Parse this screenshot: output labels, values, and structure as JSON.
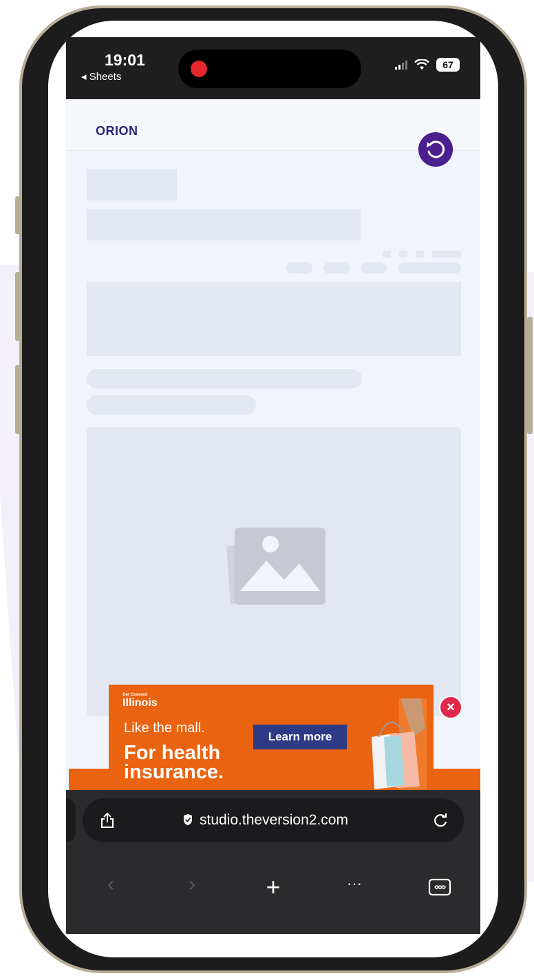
{
  "status_bar": {
    "time": "19:01",
    "back_app": "◂ Sheets",
    "battery": "67"
  },
  "app": {
    "logo": "ORION",
    "refresh_icon": "refresh-icon"
  },
  "ad": {
    "brand_small": "Get Covered",
    "brand": "Illinois",
    "line1": "Like the mall.",
    "line2": "For health insurance.",
    "cta": "Learn more",
    "close": "×"
  },
  "browser": {
    "url": "studio.theversion2.com",
    "nav": {
      "back": "‹",
      "forward": "›",
      "new_tab": "+",
      "more": "···"
    }
  }
}
